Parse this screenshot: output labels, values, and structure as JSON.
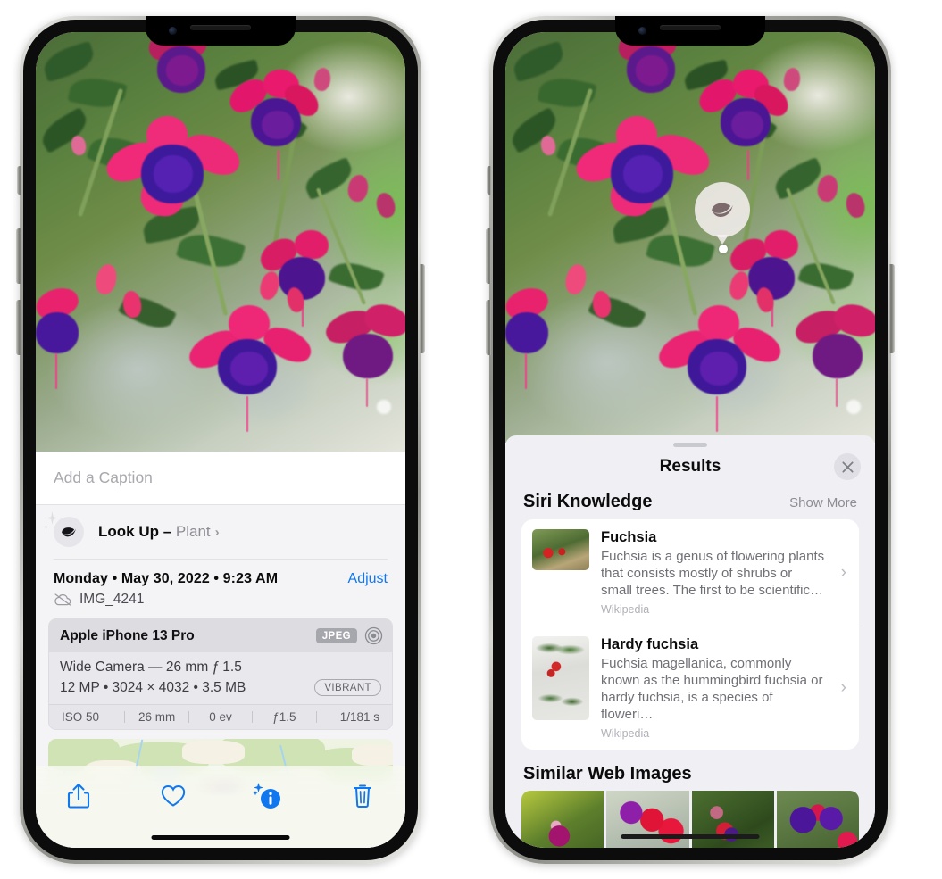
{
  "left_phone": {
    "caption_field": {
      "placeholder": "Add a Caption",
      "value": ""
    },
    "look_up": {
      "label": "Look Up – ",
      "subject": "Plant",
      "chevron": "›",
      "icon": "leaf-icon"
    },
    "date_line": {
      "text": "Monday • May 30, 2022 • 9:23 AM",
      "adjust_label": "Adjust"
    },
    "file": {
      "name": "IMG_4241",
      "icon": "icloud-slash-icon"
    },
    "metadata_card": {
      "device": "Apple iPhone 13 Pro",
      "format_badge": "JPEG",
      "aperture_icon": "aperture-icon",
      "lens_line": "Wide Camera — 26 mm ƒ 1.5",
      "size_line": "12 MP • 3024 × 4032 • 3.5 MB",
      "style_badge": "VIBRANT",
      "exif": [
        "ISO 50",
        "26 mm",
        "0 ev",
        "ƒ1.5",
        "1/181 s"
      ]
    },
    "toolbar": [
      {
        "name": "share-button",
        "icon": "share-icon"
      },
      {
        "name": "favorite-button",
        "icon": "heart-icon"
      },
      {
        "name": "info-button",
        "icon": "info-sparkle-icon"
      },
      {
        "name": "delete-button",
        "icon": "trash-icon"
      }
    ],
    "accent_color": "#1177ef"
  },
  "right_phone": {
    "badge": {
      "icon": "leaf-icon",
      "name": "visual-lookup-badge"
    },
    "panel": {
      "title": "Results",
      "close_icon": "close-icon",
      "siri_knowledge": {
        "title": "Siri Knowledge",
        "action": "Show More",
        "cards": [
          {
            "title": "Fuchsia",
            "description": "Fuchsia is a genus of flowering plants that consists mostly of shrubs or small trees. The first to be scientific…",
            "source": "Wikipedia",
            "chevron": "›"
          },
          {
            "title": "Hardy fuchsia",
            "description": "Fuchsia magellanica, commonly known as the hummingbird fuchsia or hardy fuchsia, is a species of floweri…",
            "source": "Wikipedia",
            "chevron": "›"
          }
        ]
      },
      "similar_web_images": {
        "title": "Similar Web Images",
        "count": 4
      }
    }
  }
}
